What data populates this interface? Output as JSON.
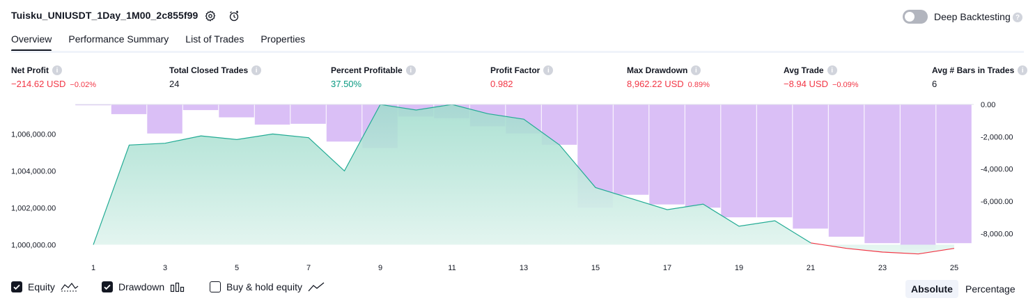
{
  "header": {
    "title": "Tuisku_UNIUSDT_1Day_1M00_2c855f99",
    "deep_backtesting_label": "Deep Backtesting",
    "help_glyph": "?"
  },
  "tabs": [
    {
      "label": "Overview",
      "active": true
    },
    {
      "label": "Performance Summary",
      "active": false
    },
    {
      "label": "List of Trades",
      "active": false
    },
    {
      "label": "Properties",
      "active": false
    }
  ],
  "metrics": [
    {
      "label": "Net Profit",
      "value": "−214.62 USD",
      "sub": "−0.02%",
      "color": "#f23645"
    },
    {
      "label": "Total Closed Trades",
      "value": "24",
      "sub": "",
      "color": "#131722"
    },
    {
      "label": "Percent Profitable",
      "value": "37.50%",
      "sub": "",
      "color": "#089981"
    },
    {
      "label": "Profit Factor",
      "value": "0.982",
      "sub": "",
      "color": "#f23645"
    },
    {
      "label": "Max Drawdown",
      "value": "8,962.22 USD",
      "sub": "0.89%",
      "color": "#f23645"
    },
    {
      "label": "Avg Trade",
      "value": "−8.94 USD",
      "sub": "−0.09%",
      "color": "#f23645"
    },
    {
      "label": "Avg # Bars in Trades",
      "value": "6",
      "sub": "",
      "color": "#131722"
    }
  ],
  "legend": {
    "equity_label": "Equity",
    "equity_checked": true,
    "drawdown_label": "Drawdown",
    "drawdown_checked": true,
    "buyhold_label": "Buy & hold equity",
    "buyhold_checked": false
  },
  "mode": {
    "absolute_label": "Absolute",
    "percentage_label": "Percentage",
    "selected": "Absolute"
  },
  "colors": {
    "equity_line": "#22ab94",
    "equity_fill": "#b2e5d9",
    "equity_below_line": "#f23645",
    "drawdown_fill": "#d6b8f5",
    "text": "#131722",
    "loss": "#f23645",
    "profit": "#089981"
  },
  "chart_data": {
    "type": "area",
    "x": [
      1,
      2,
      3,
      4,
      5,
      6,
      7,
      8,
      9,
      10,
      11,
      12,
      13,
      14,
      15,
      16,
      17,
      18,
      19,
      20,
      21,
      22,
      23,
      24,
      25
    ],
    "x_ticks": [
      "1",
      "3",
      "5",
      "7",
      "9",
      "11",
      "13",
      "15",
      "17",
      "19",
      "21",
      "23",
      "25"
    ],
    "y_left_ticks": [
      "1,000,000.00",
      "1,002,000.00",
      "1,004,000.00",
      "1,006,000.00"
    ],
    "y_right_ticks": [
      "0.00",
      "-2,000.00",
      "-4,000.00",
      "-6,000.00",
      "-8,000.00"
    ],
    "left_ylim": [
      999300,
      1007600
    ],
    "right_ylim": [
      -9500,
      0
    ],
    "baseline": 1000000,
    "series": [
      {
        "name": "Equity",
        "type": "line",
        "axis": "left",
        "values": [
          1000000,
          1005400,
          1005500,
          1005900,
          1005700,
          1006000,
          1005800,
          1004000,
          1007600,
          1007300,
          1007600,
          1007100,
          1006800,
          1005400,
          1003100,
          1002500,
          1001900,
          1002200,
          1001000,
          1001300,
          1000100,
          999800,
          999600,
          999500,
          999800
        ]
      },
      {
        "name": "Drawdown",
        "type": "bar",
        "axis": "right",
        "values": [
          -50,
          -600,
          -1800,
          -350,
          -800,
          -1250,
          -1200,
          -2300,
          -2700,
          -750,
          -850,
          -1350,
          -1800,
          -2500,
          -6400,
          -5600,
          -6200,
          -6400,
          -7000,
          -7000,
          -7700,
          -8200,
          -8600,
          -9000,
          -8600
        ]
      }
    ]
  }
}
